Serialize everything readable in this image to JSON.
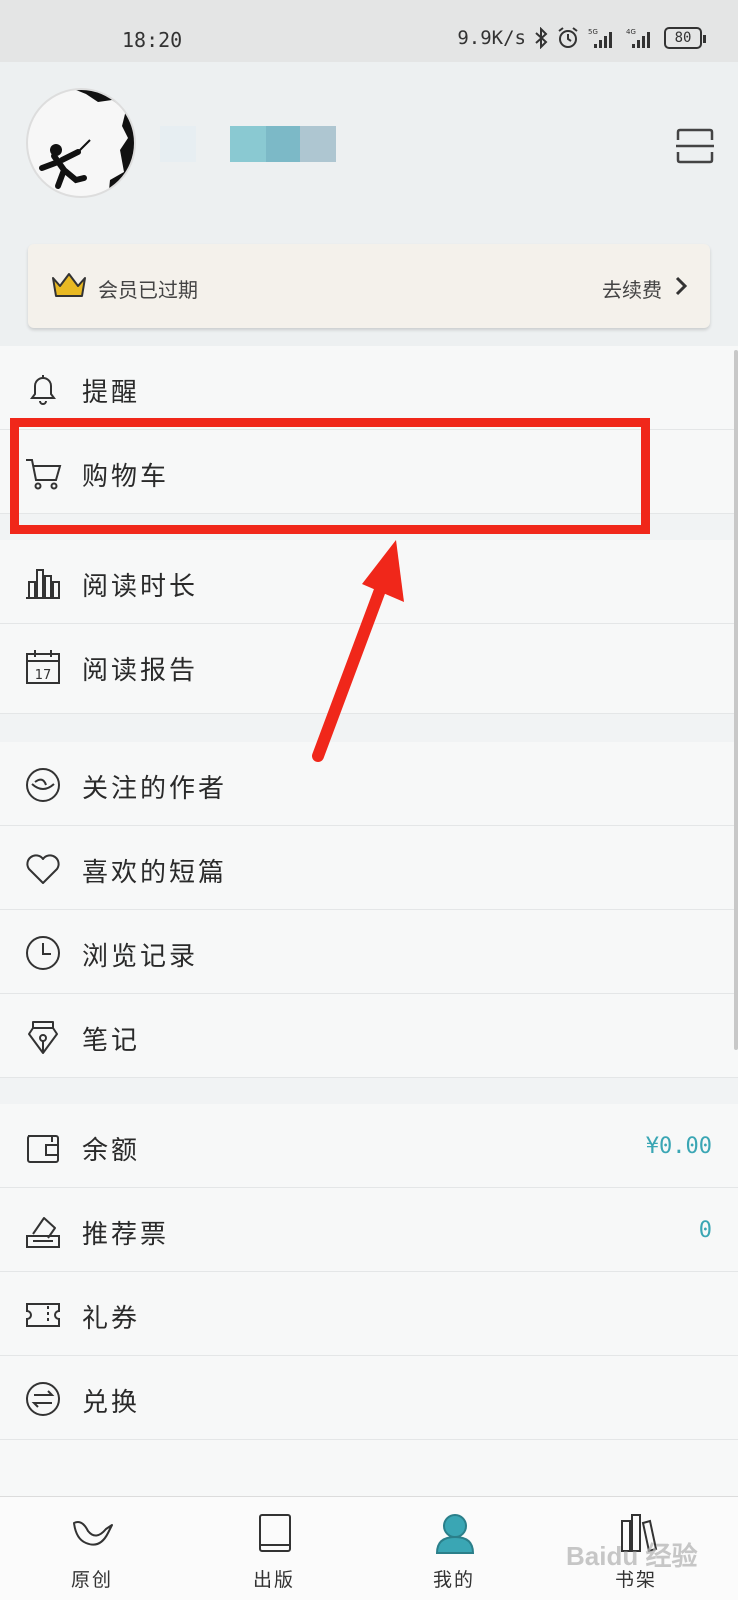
{
  "status_bar": {
    "time": "18:20",
    "network_speed": "9.9K/s",
    "battery": "80"
  },
  "profile": {
    "avatar_icon": "climber-silhouette-avatar",
    "scan_icon": "scan-icon"
  },
  "vip": {
    "status": "会员已过期",
    "renew_label": "去续费",
    "crown_color": "#e8b923"
  },
  "menu": {
    "reminders": "提醒",
    "cart": "购物车",
    "reading_time": "阅读时长",
    "reading_report": "阅读报告",
    "calendar_day": "17",
    "followed_authors": "关注的作者",
    "liked_shorts": "喜欢的短篇",
    "history": "浏览记录",
    "notes": "笔记",
    "balance": "余额",
    "balance_value": "¥0.00",
    "recommend_tickets": "推荐票",
    "recommend_tickets_value": "0",
    "coupons": "礼券",
    "exchange": "兑换"
  },
  "tabs": {
    "original": "原创",
    "publish": "出版",
    "mine": "我的",
    "bookshelf": "书架",
    "active_color": "#3aa6b4"
  },
  "annotation": {
    "highlight_color": "#f0271a"
  },
  "watermark": "Baidu 经验"
}
